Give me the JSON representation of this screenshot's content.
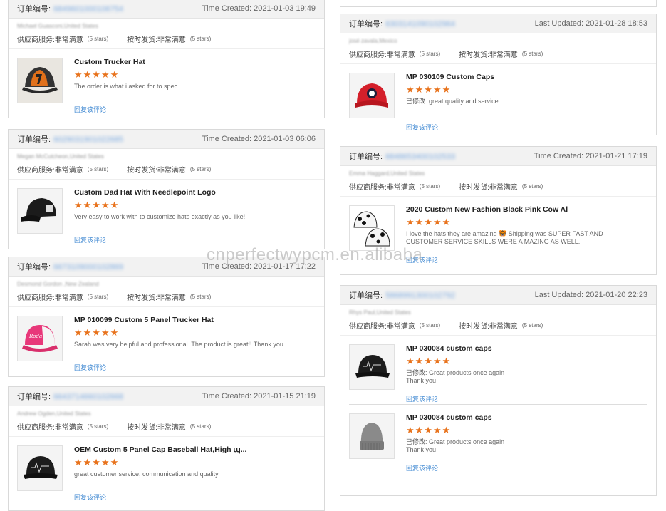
{
  "labels": {
    "order": "订单编号:",
    "supplier_service": "供应商服务:",
    "on_time": "按时发货:",
    "very_satisfied": "非常满意",
    "five_stars": "(5 stars)",
    "reply": "回复该评论",
    "edited": "已修改:",
    "time_created": "Time Created:",
    "last_updated": "Last Updated:"
  },
  "watermark": "cnperfectwypcm.en.alibaba",
  "left_cards": [
    {
      "order_id": "6849601000106754",
      "time_label": "Time Created:",
      "time": "2021-01-03 19:49",
      "buyer": "Michael Guasconi,United States",
      "products": [
        {
          "name": "Custom Trucker Hat",
          "stars": "★★★★★",
          "review": "The order is what i asked for to spec.",
          "edited": false,
          "icon": "trucker-hat-orange-icon"
        }
      ]
    },
    {
      "order_id": "6029031901022685",
      "time_label": "Time Created:",
      "time": "2021-01-03 06:06",
      "buyer": "Megan McCutcheon,United States",
      "products": [
        {
          "name": "Custom Dad Hat With Needlepoint Logo",
          "stars": "★★★★★",
          "review": "Very easy to work with to customize hats exactly as you like!",
          "edited": false,
          "icon": "dad-hat-black-icon"
        }
      ]
    },
    {
      "order_id": "6673109000102869",
      "time_label": "Time Created:",
      "time": "2021-01-17 17:22",
      "buyer": "Desmond Gordon ,New Zealand",
      "products": [
        {
          "name": "MP 010099 Custom 5 Panel Trucker Hat",
          "stars": "★★★★★",
          "review": "Sarah was very helpful and professional. The product is great!! Thank you",
          "edited": false,
          "icon": "trucker-hat-pink-icon"
        }
      ]
    },
    {
      "order_id": "6643714660102668",
      "time_label": "Time Created:",
      "time": "2021-01-15 21:19",
      "buyer": "Andrew Ogden,United States",
      "products": [
        {
          "name": "OEM Custom 5 Panel Cap Baseball Hat,High պ...",
          "stars": "★★★★★",
          "review": "great customer service, communication and quality",
          "edited": false,
          "icon": "baseball-cap-black-icon"
        }
      ]
    }
  ],
  "right_cards": [
    {
      "order_id": "6303141090102964",
      "time_label": "Last Updated:",
      "time": "2021-01-28 18:53",
      "buyer": "josé zavala,Mexico",
      "products": [
        {
          "name": "MP 030109 Custom Caps",
          "stars": "★★★★★",
          "review": "great quality and service",
          "edited": true,
          "icon": "baseball-cap-red-icon"
        }
      ]
    },
    {
      "order_id": "6848653400102533",
      "time_label": "Time Created:",
      "time": "2021-01-21 17:19",
      "buyer": "Emma Haggard,United States",
      "products": [
        {
          "name": "2020 Custom New Fashion Black Pink Cow Al",
          "stars": "★★★★★",
          "review": "I love the hats they are amazing 🐯 Shipping was SUPER FAST AND CUSTOMER SERVICE SKILLS WERE A MAZING AS WELL.",
          "edited": false,
          "icon": "bucket-hat-cow-icon"
        }
      ]
    },
    {
      "order_id": "5868991300102792",
      "time_label": "Last Updated:",
      "time": "2021-01-20 22:23",
      "buyer": "Rhys Paul,United States",
      "products": [
        {
          "name": "MP 030084 custom caps",
          "stars": "★★★★★",
          "review": "Great products once again\nThank you",
          "edited": true,
          "icon": "baseball-cap-black-icon"
        },
        {
          "name": "MP 030084 custom caps",
          "stars": "★★★★★",
          "review": "Great products once again\nThank you",
          "edited": true,
          "icon": "beanie-grey-icon"
        }
      ]
    }
  ],
  "colors": {
    "star": "#e8731d",
    "link": "#3b86d1",
    "header_bg": "#f2f2f2"
  }
}
